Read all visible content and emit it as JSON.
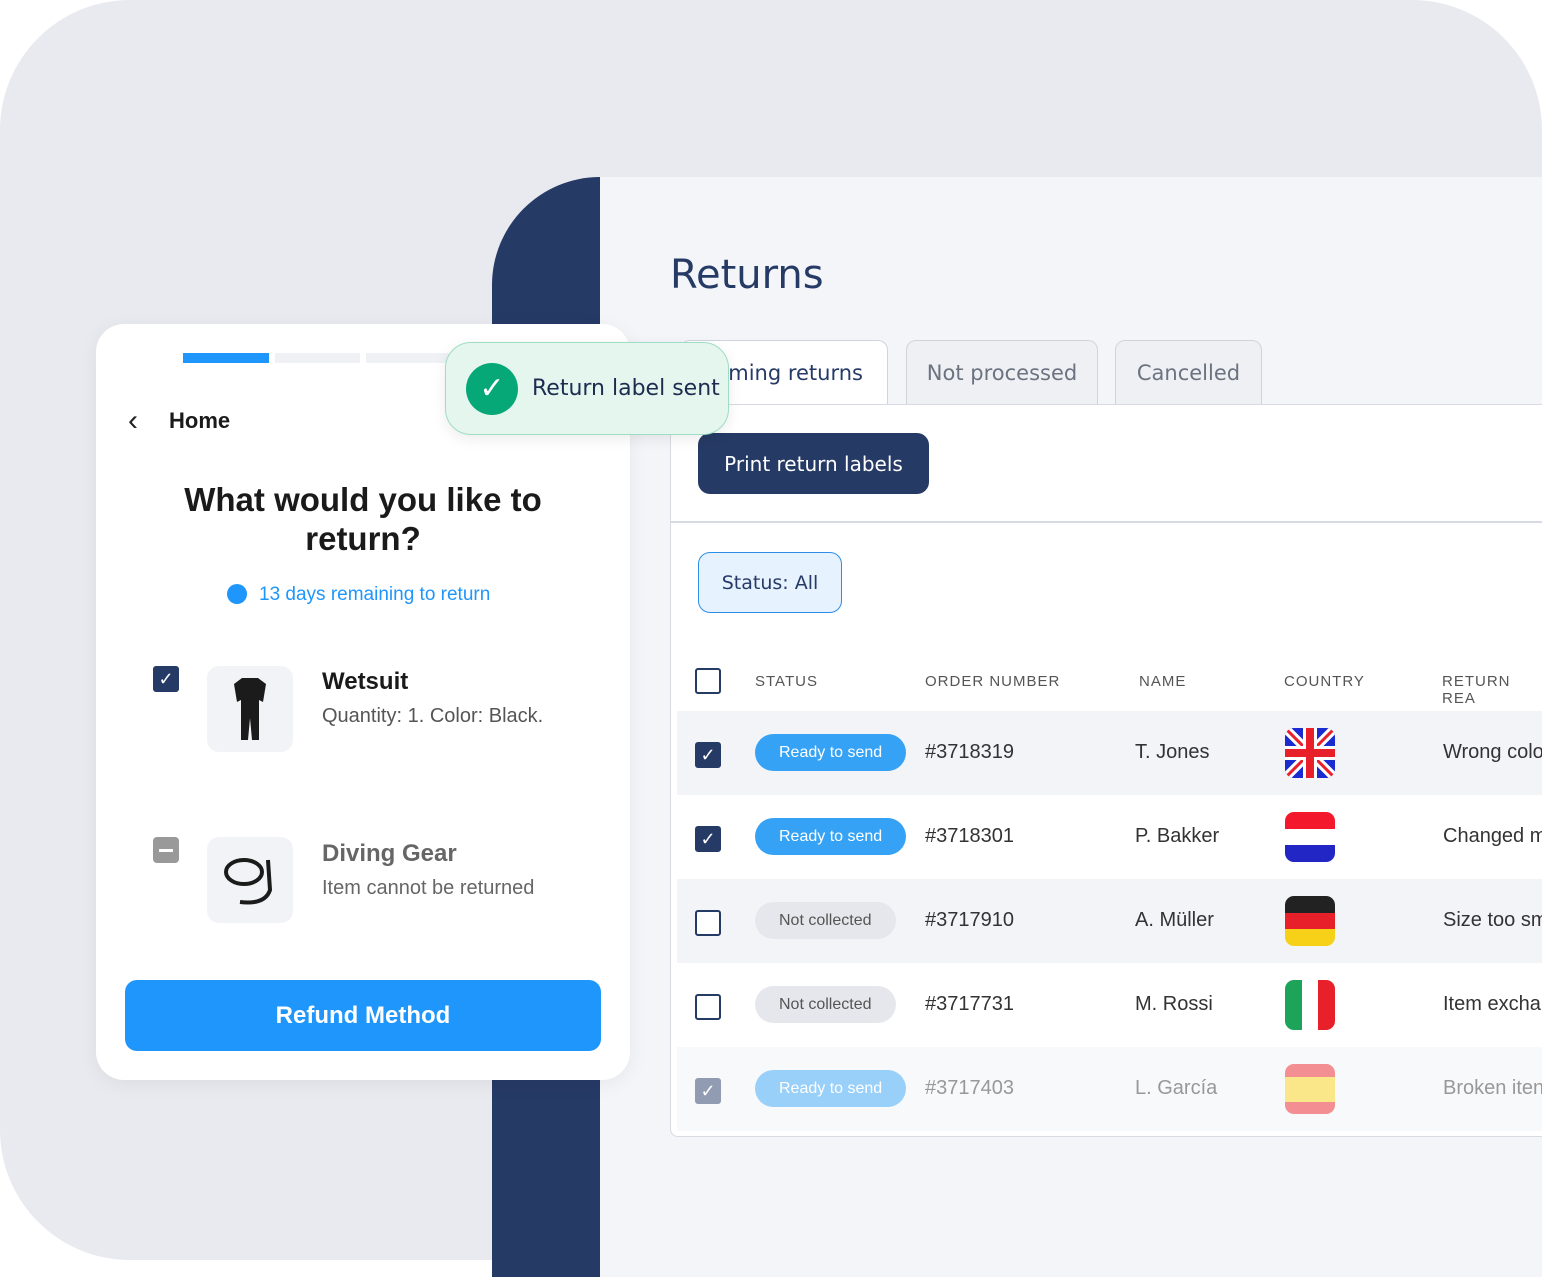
{
  "admin": {
    "title": "Returns",
    "tabs": [
      {
        "label": "Incoming returns",
        "visible_label": "oming returns",
        "active": true
      },
      {
        "label": "Not processed"
      },
      {
        "label": "Cancelled"
      }
    ],
    "print_button": "Print return labels",
    "status_filter": "Status: All",
    "columns": [
      "STATUS",
      "ORDER NUMBER",
      "NAME",
      "COUNTRY",
      "RETURN REA"
    ],
    "rows": [
      {
        "checked": true,
        "status": "Ready to send",
        "order": "#3718319",
        "name": "T. Jones",
        "country": "uk-flag",
        "reason": "Wrong colo"
      },
      {
        "checked": true,
        "status": "Ready to send",
        "order": "#3718301",
        "name": "P. Bakker",
        "country": "netherlands-flag",
        "reason": "Changed m"
      },
      {
        "checked": false,
        "status": "Not collected",
        "order": "#3717910",
        "name": "A. Müller",
        "country": "germany-flag",
        "reason": "Size too sm"
      },
      {
        "checked": false,
        "status": "Not collected",
        "order": "#3717731",
        "name": "M. Rossi",
        "country": "italy-flag",
        "reason": "Item excha"
      },
      {
        "checked": true,
        "status": "Ready to send",
        "order": "#3717403",
        "name": "L. García",
        "country": "spain-flag",
        "reason": "Broken iten"
      }
    ]
  },
  "portal": {
    "back_label": "Home",
    "heading": "What would you like to return?",
    "remaining": "13 days remaining to return",
    "progress_step": 1,
    "progress_steps": 3,
    "items": [
      {
        "name": "Wetsuit",
        "detail": "Quantity: 1. Color: Black.",
        "checked": true
      },
      {
        "name": "Diving Gear",
        "detail": "Item cannot be returned",
        "disabled": true
      }
    ],
    "refund_button": "Refund Method"
  },
  "toast": {
    "message": "Return label sent"
  },
  "colors": {
    "navy": "#263a66",
    "blue": "#1f96fb",
    "success": "#06a877"
  }
}
